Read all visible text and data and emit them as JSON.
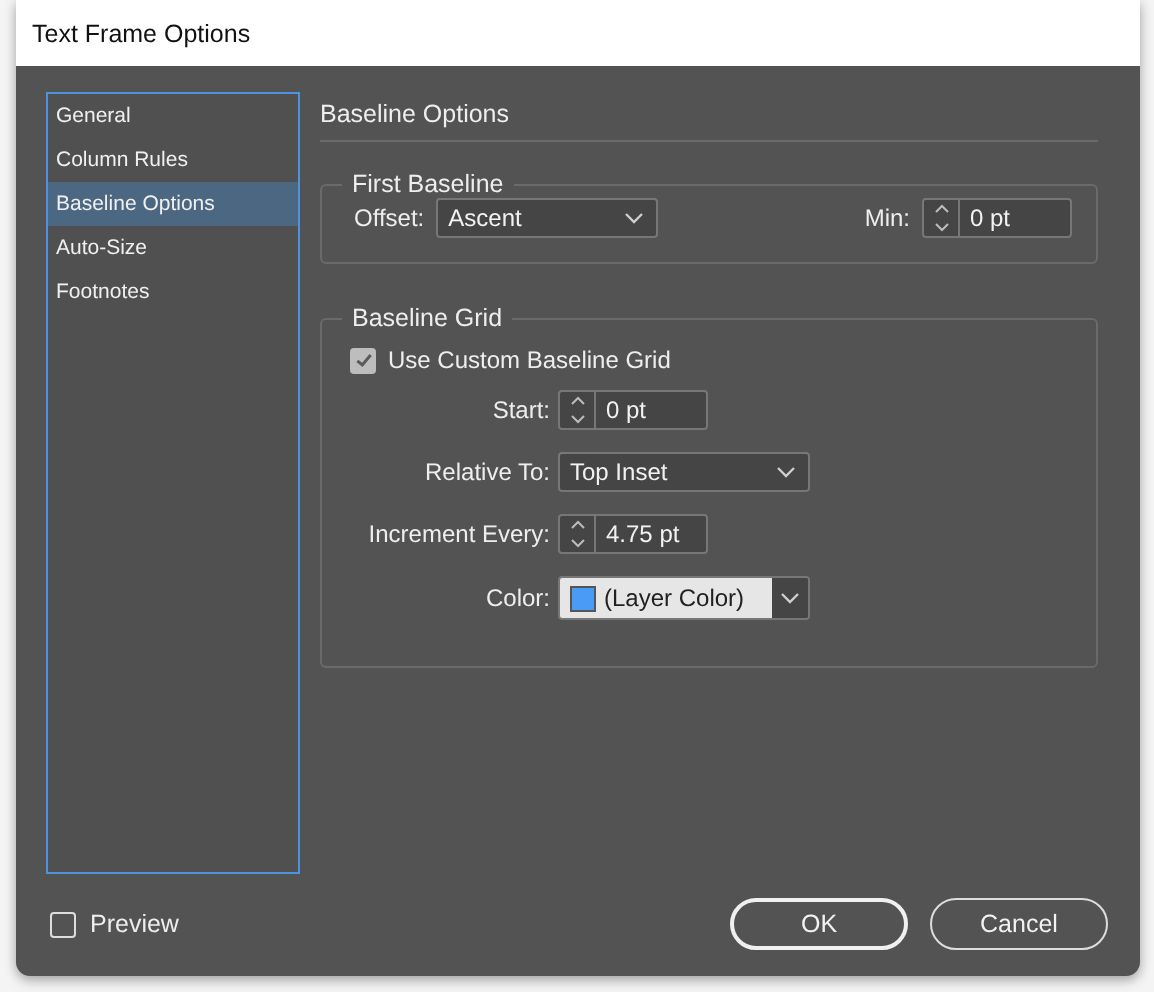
{
  "window": {
    "title": "Text Frame Options"
  },
  "sidebar": {
    "items": [
      {
        "label": "General",
        "selected": false
      },
      {
        "label": "Column Rules",
        "selected": false
      },
      {
        "label": "Baseline Options",
        "selected": true
      },
      {
        "label": "Auto-Size",
        "selected": false
      },
      {
        "label": "Footnotes",
        "selected": false
      }
    ]
  },
  "panel": {
    "title": "Baseline Options",
    "first_baseline": {
      "title": "First Baseline",
      "offset": {
        "label": "Offset:",
        "value": "Ascent"
      },
      "min": {
        "label": "Min:",
        "value": "0 pt"
      }
    },
    "baseline_grid": {
      "title": "Baseline Grid",
      "use_custom": {
        "label": "Use Custom Baseline Grid",
        "checked": true
      },
      "fields": [
        {
          "kind": "spinner",
          "label": "Start:",
          "value": "0 pt"
        },
        {
          "kind": "dropdown",
          "label": "Relative To:",
          "value": "Top Inset"
        },
        {
          "kind": "spinner",
          "label": "Increment Every:",
          "value": "4.75 pt"
        },
        {
          "kind": "color",
          "label": "Color:",
          "value": "(Layer Color)",
          "color": "#4a9bf5"
        }
      ]
    }
  },
  "preview": {
    "label": "Preview",
    "checked": false
  },
  "buttons": [
    {
      "label": "OK",
      "default": true
    },
    {
      "label": "Cancel",
      "default": false
    }
  ]
}
